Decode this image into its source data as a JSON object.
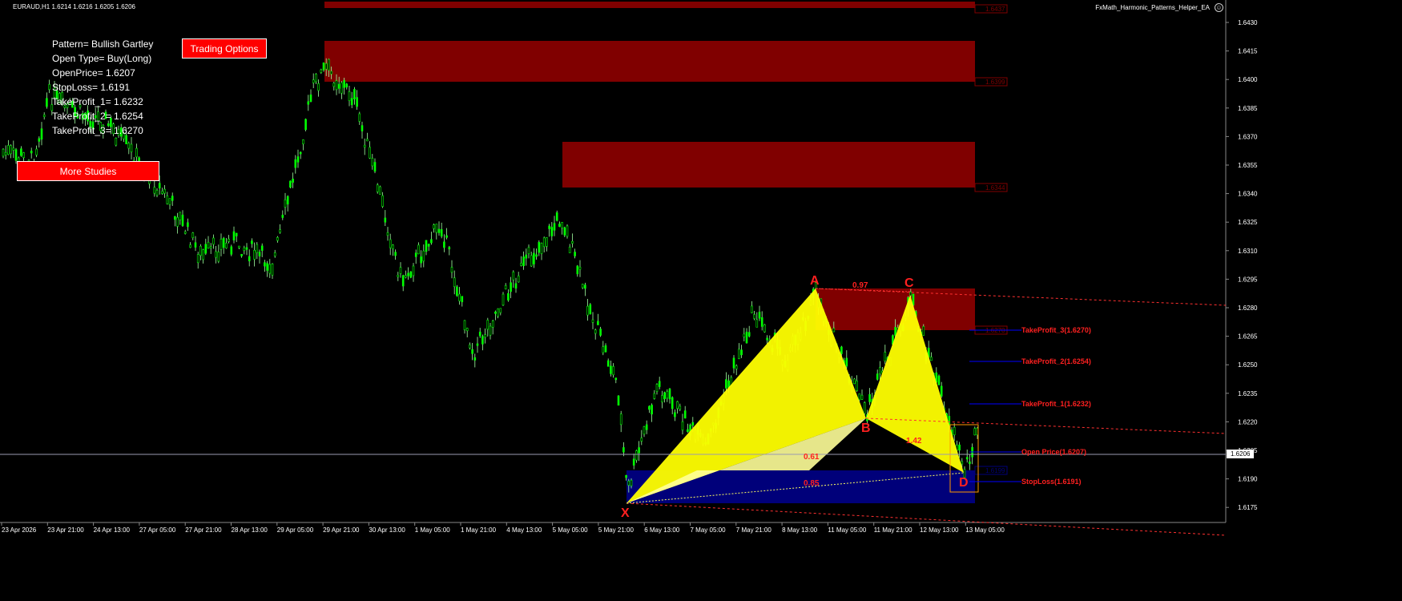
{
  "header": {
    "symbol_line": "EURAUD,H1  1.6214 1.6216 1.6205 1.6206",
    "ea_name": "FxMath_Harmonic_Patterns_Helper_EA",
    "ea_icon": "smiley-icon"
  },
  "info_panel": {
    "pattern": "Pattern= Bullish Gartley",
    "open_type": "Open Type= Buy(Long)",
    "open_price": "OpenPrice= 1.6207",
    "stop_loss": "StopLoss= 1.6191",
    "take_profit_1": "TakeProfit_1= 1.6232",
    "take_profit_2": "TakeProfit_2= 1.6254",
    "take_profit_3": "TakeProfit_3= 1.6270"
  },
  "buttons": {
    "trading_options": "Trading Options",
    "more_studies": "More Studies"
  },
  "colors": {
    "background": "#000000",
    "candle_bull": "#00ff00",
    "candle_wick": "#a0ffa0",
    "zone_red": "#800000",
    "zone_blue": "#00007a",
    "pattern_yellow": "#ffff00",
    "label_red": "#ff2020",
    "level_blue": "#0000ff"
  },
  "price_axis": {
    "ticks": [
      "1.6430",
      "1.6415",
      "1.6400",
      "1.6385",
      "1.6370",
      "1.6355",
      "1.6340",
      "1.6325",
      "1.6310",
      "1.6295",
      "1.6280",
      "1.6265",
      "1.6250",
      "1.6235",
      "1.6220",
      "1.6205",
      "1.6190",
      "1.6175"
    ],
    "current_price": "1.6206",
    "min": 1.617,
    "max": 1.6437
  },
  "time_axis": {
    "ticks": [
      "23 Apr 2026",
      "23 Apr 21:00",
      "24 Apr 13:00",
      "27 Apr 05:00",
      "27 Apr 21:00",
      "28 Apr 13:00",
      "29 Apr 05:00",
      "29 Apr 21:00",
      "30 Apr 13:00",
      "1 May 05:00",
      "1 May 21:00",
      "4 May 13:00",
      "5 May 05:00",
      "5 May 21:00",
      "6 May 13:00",
      "7 May 05:00",
      "7 May 21:00",
      "8 May 13:00",
      "11 May 05:00",
      "11 May 21:00",
      "12 May 13:00",
      "13 May 05:00"
    ]
  },
  "zone_labels": {
    "z1": "1.6437",
    "z2": "1.6399",
    "z3": "1.6344",
    "z4": "1.6270",
    "z5": "1.6199"
  },
  "pattern": {
    "points": {
      "X": "X",
      "A": "A",
      "B": "B",
      "C": "C",
      "D": "D"
    },
    "ratios": {
      "xb": "0.61",
      "ac": "0.97",
      "bd": "1.42",
      "xd": "0.85"
    },
    "prices": {
      "X": 1.6179,
      "A": 1.6292,
      "B": 1.6223,
      "C": 1.629,
      "D": 1.6196
    }
  },
  "levels": {
    "tp3": "TakeProfit_3(1.6270)",
    "tp2": "TakeProfit_2(1.6254)",
    "tp1": "TakeProfit_1(1.6232)",
    "open": "Open Price(1.6207)",
    "sl": "StopLoss(1.6191)"
  }
}
